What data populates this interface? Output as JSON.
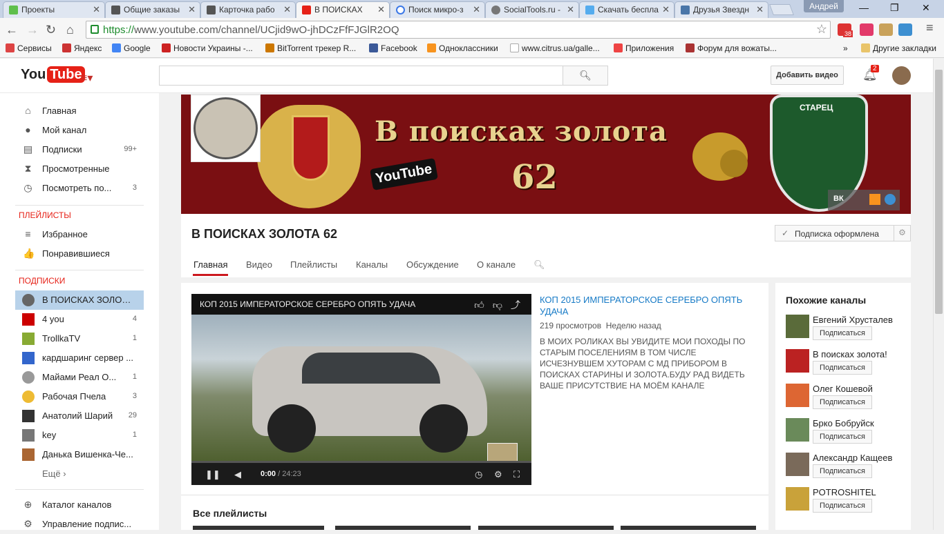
{
  "browser": {
    "tabs": [
      {
        "title": "Проекты",
        "color": "#5fbf4c"
      },
      {
        "title": "Общие заказы",
        "color": "#555555"
      },
      {
        "title": "Карточка рабо",
        "color": "#555555"
      },
      {
        "title": "В ПОИСКАХ",
        "color": "#e62117"
      },
      {
        "title": "Поиск микро-з",
        "color": "#3b78e7"
      },
      {
        "title": "SocialTools.ru -",
        "color": "#777777"
      },
      {
        "title": "Скачать беспла",
        "color": "#55acee"
      },
      {
        "title": "Друзья Звездн",
        "color": "#4a76a8"
      }
    ],
    "user": "Андрей",
    "url_scheme": "https://",
    "url_rest": "www.youtube.com/channel/UCjid9wO-jhDCzFfFJGlR2OQ",
    "bookmarks": [
      {
        "label": "Сервисы",
        "color": "#d44"
      },
      {
        "label": "Яндекс",
        "color": "#c33"
      },
      {
        "label": "Google",
        "color": "#4285f4"
      },
      {
        "label": "Новости Украины -...",
        "color": "#c22"
      },
      {
        "label": "BitTorrent трекер R...",
        "color": "#c70"
      },
      {
        "label": "Facebook",
        "color": "#3b5998"
      },
      {
        "label": "Одноклассники",
        "color": "#f7931e"
      },
      {
        "label": "www.citrus.ua/galle...",
        "color": "#ccc"
      },
      {
        "label": "Приложения",
        "color": "#e44"
      },
      {
        "label": "Форум для вожаты...",
        "color": "#a33"
      }
    ],
    "other_bookmarks": "Другие закладки",
    "mail_count": "38"
  },
  "yt": {
    "logo_you": "You",
    "logo_tube": "Tube",
    "upload_label": "Добавить видео",
    "notifications": "2"
  },
  "sidebar": {
    "nav": [
      {
        "icon": "⌂",
        "label": "Главная",
        "count": ""
      },
      {
        "icon": "●",
        "label": "Мой канал",
        "count": ""
      },
      {
        "icon": "▤",
        "label": "Подписки",
        "count": "99+"
      },
      {
        "icon": "⧗",
        "label": "Просмотренные",
        "count": ""
      },
      {
        "icon": "◷",
        "label": "Посмотреть по...",
        "count": "3"
      }
    ],
    "playlists_head": "ПЛЕЙЛИСТЫ",
    "playlists": [
      {
        "icon": "≡",
        "label": "Избранное"
      },
      {
        "icon": "👍",
        "label": "Понравившиеся"
      }
    ],
    "subs_head": "ПОДПИСКИ",
    "subs": [
      {
        "label": "В ПОИСКАХ ЗОЛОТА...",
        "count": "",
        "color": "#666"
      },
      {
        "label": "4 you",
        "count": "4",
        "color": "#c00"
      },
      {
        "label": "TrollkaTV",
        "count": "1",
        "color": "#8a3"
      },
      {
        "label": "кардшаринг сервер ...",
        "count": "",
        "color": "#36c"
      },
      {
        "label": "Майами Реал О...",
        "count": "1",
        "color": "#999"
      },
      {
        "label": "Рабочая Пчела",
        "count": "3",
        "color": "#eb3"
      },
      {
        "label": "Анатолий Шарий",
        "count": "29",
        "color": "#333"
      },
      {
        "label": "key",
        "count": "1",
        "color": "#777"
      },
      {
        "label": "Данька Вишенка-Че...",
        "count": "",
        "color": "#a63"
      }
    ],
    "more": "Ещё ›",
    "bottom": [
      {
        "icon": "⊕",
        "label": "Каталог каналов"
      },
      {
        "icon": "⚙",
        "label": "Управление подпис..."
      }
    ]
  },
  "banner": {
    "title": "В поисках золота",
    "number": "62",
    "yt_badge": "YouTube",
    "shield_text": "СТАРЕЦ",
    "social_vk": "ВК"
  },
  "channel": {
    "name": "В ПОИСКАХ ЗОЛОТА 62",
    "subscribed": "Подписка оформлена",
    "tabs": [
      "Главная",
      "Видео",
      "Плейлисты",
      "Каналы",
      "Обсуждение",
      "О канале"
    ]
  },
  "video": {
    "title": "КОП 2015 ИМПЕРАТОРСКОЕ СЕРЕБРО ОПЯТЬ УДАЧА",
    "current": "0:00",
    "duration": "/ 24:23",
    "views": "219 просмотров",
    "age": "Неделю назад",
    "description": "В МОИХ РОЛИКАХ ВЫ УВИДИТЕ МОИ ПОХОДЫ ПО СТАРЫМ ПОСЕЛЕНИЯМ В ТОМ ЧИСЛЕ ИСЧЕЗНУВШЕМ ХУТОРАМ С МД ПРИБОРОМ В ПОИСКАХ СТАРИНЫ И ЗОЛОТА.БУДУ РАД ВИДЕТЬ ВАШЕ ПРИСУТСТВИЕ НА МОЁМ КАНАЛЕ"
  },
  "playlists_heading": "Все плейлисты",
  "related": {
    "heading": "Похожие каналы",
    "button": "Подписаться",
    "channels": [
      {
        "name": "Евгений Хрусталев",
        "color": "#5a6b3a"
      },
      {
        "name": "В поисках золота!",
        "color": "#b22"
      },
      {
        "name": "Олег Кошевой",
        "color": "#d63"
      },
      {
        "name": "Брко Бобруйск",
        "color": "#6a8a5a"
      },
      {
        "name": "Александр Кащеев",
        "color": "#7a6a5a"
      },
      {
        "name": "POTROSHITEL",
        "color": "#c9a23a"
      }
    ]
  }
}
